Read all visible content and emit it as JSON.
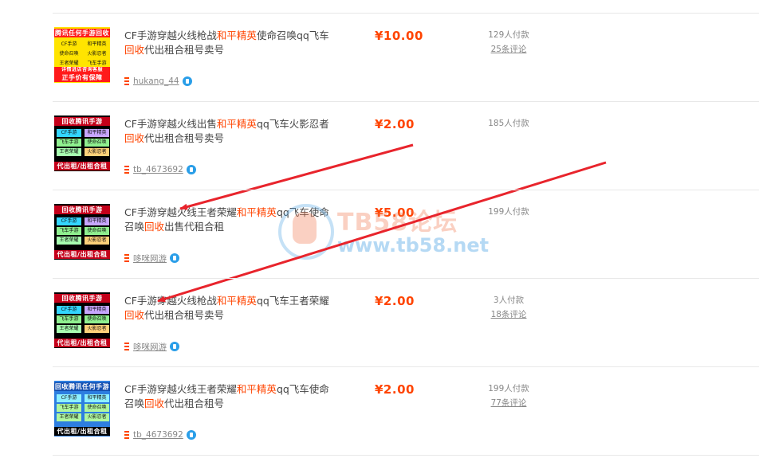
{
  "items": [
    {
      "title_parts": [
        "CF手游穿越火线枪战",
        "和平精英",
        "使命召唤qq飞车",
        "回收",
        "代出租合租号卖号"
      ],
      "seller": "hukang_44",
      "price": "¥10.00",
      "paid": "129人付款",
      "reviews": "25条评论",
      "thumb": {
        "style": "light",
        "bg": "#ffe400",
        "top": "腾讯任何手游回收",
        "top_bg": "#ff1a1a",
        "grid": [
          "CF手游",
          "和平精英",
          "使命召唤",
          "火影忍者",
          "王者荣耀",
          "飞车手游"
        ],
        "line": "详情进店咨询客服",
        "line_bg": "#ff1a1a",
        "bottom": "正手价有保障",
        "bottom_bg": "#ff1a1a"
      }
    },
    {
      "title_parts": [
        "CF手游穿越火线出售",
        "和平精英",
        "qq飞车火影忍者",
        "回收",
        "代出租合租号卖号"
      ],
      "seller": "tb_4673692",
      "price": "¥2.00",
      "paid": "185人付款",
      "reviews": "",
      "thumb": {
        "style": "dark",
        "bg": "#000000",
        "top": "回收腾讯手游",
        "top_bg": "#c4001a",
        "grid": [
          "CF手游",
          "和平精英",
          "飞车手游",
          "使命召唤",
          "王者荣耀",
          "火影忍者"
        ],
        "line": "",
        "line_bg": "#000000",
        "bottom": "代出租/出租合租",
        "bottom_bg": "#c4001a"
      }
    },
    {
      "title_parts": [
        "CF手游穿越火线王者荣耀",
        "和平精英",
        "qq飞车使命召唤",
        "回收",
        "出售代租合租"
      ],
      "seller": "哆咪网游",
      "price": "¥5.00",
      "paid": "199人付款",
      "reviews": "",
      "thumb": {
        "style": "dark",
        "bg": "#000000",
        "top": "回收腾讯手游",
        "top_bg": "#c4001a",
        "grid": [
          "CF手游",
          "和平精英",
          "飞车手游",
          "使命召唤",
          "王者荣耀",
          "火影忍者"
        ],
        "line": "",
        "line_bg": "#000000",
        "bottom": "代出租/出租合租",
        "bottom_bg": "#c4001a"
      }
    },
    {
      "title_parts": [
        "CF手游穿越火线枪战",
        "和平精英",
        "qq飞车王者荣耀",
        "回收",
        "代出租合租号卖号"
      ],
      "seller": "哆咪网游",
      "price": "¥2.00",
      "paid": "3人付款",
      "reviews": "18条评论",
      "thumb": {
        "style": "dark",
        "bg": "#000000",
        "top": "回收腾讯手游",
        "top_bg": "#c4001a",
        "grid": [
          "CF手游",
          "和平精英",
          "飞车手游",
          "使命召唤",
          "王者荣耀",
          "火影忍者"
        ],
        "line": "",
        "line_bg": "#000000",
        "bottom": "代出租/出租合租",
        "bottom_bg": "#c4001a"
      }
    },
    {
      "title_parts": [
        "CF手游穿越火线王者荣耀",
        "和平精英",
        "qq飞车使命召唤",
        "回收",
        "代出租合租号"
      ],
      "seller": "tb_4673692",
      "price": "¥2.00",
      "paid": "199人付款",
      "reviews": "77条评论",
      "thumb": {
        "style": "blue",
        "bg": "#2d7ee0",
        "top": "回收腾讯任何手游",
        "top_bg": "#1650b0",
        "grid": [
          "CF手游",
          "和平精英",
          "飞车手游",
          "使命召唤",
          "王者荣耀",
          "火影忍者"
        ],
        "line": "",
        "line_bg": "#2d7ee0",
        "bottom": "代出租/出租合租",
        "bottom_bg": "#000000"
      }
    }
  ],
  "watermark": {
    "title": "TB58论坛",
    "url": "www.tb58.net"
  },
  "colors": {
    "accent": "#ff4400",
    "arrow": "#e8242c",
    "separator": "#e8e8e8"
  }
}
